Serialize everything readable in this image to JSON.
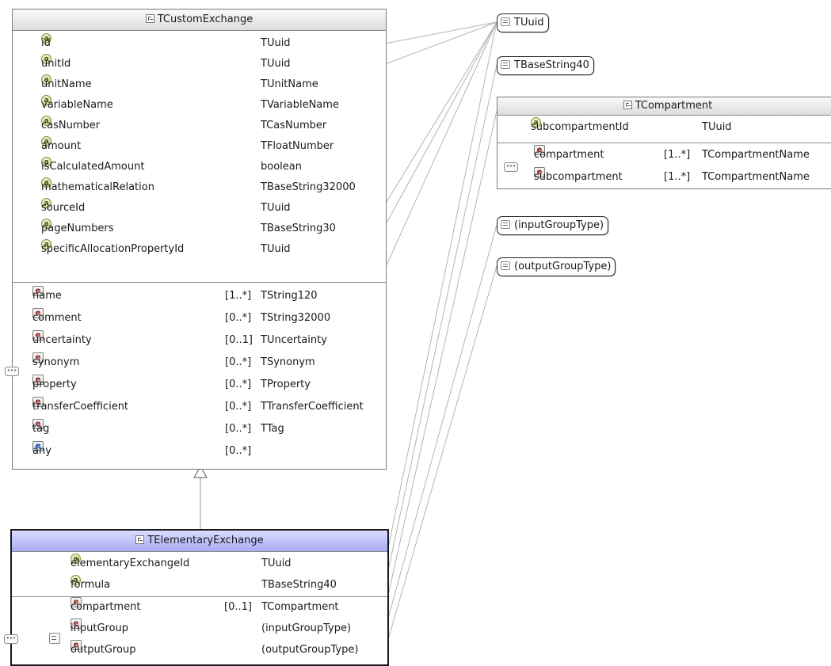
{
  "custom": {
    "title": "TCustomExchange",
    "attributes": [
      {
        "name": "id",
        "type": "TUuid"
      },
      {
        "name": "unitId",
        "type": "TUuid"
      },
      {
        "name": "unitName",
        "type": "TUnitName"
      },
      {
        "name": "variableName",
        "type": "TVariableName"
      },
      {
        "name": "casNumber",
        "type": "TCasNumber"
      },
      {
        "name": "amount",
        "type": "TFloatNumber"
      },
      {
        "name": "isCalculatedAmount",
        "type": "boolean"
      },
      {
        "name": "mathematicalRelation",
        "type": "TBaseString32000"
      },
      {
        "name": "sourceId",
        "type": "TUuid"
      },
      {
        "name": "pageNumbers",
        "type": "TBaseString30"
      },
      {
        "name": "specificAllocationPropertyId",
        "type": "TUuid"
      }
    ],
    "elements": [
      {
        "name": "name",
        "card": "[1..*]",
        "type": "TString120"
      },
      {
        "name": "comment",
        "card": "[0..*]",
        "type": "TString32000"
      },
      {
        "name": "uncertainty",
        "card": "[0..1]",
        "type": "TUncertainty"
      },
      {
        "name": "synonym",
        "card": "[0..*]",
        "type": "TSynonym"
      },
      {
        "name": "property",
        "card": "[0..*]",
        "type": "TProperty"
      },
      {
        "name": "transferCoefficient",
        "card": "[0..*]",
        "type": "TTransferCoefficient"
      },
      {
        "name": "tag",
        "card": "[0..*]",
        "type": "TTag"
      },
      {
        "name": "any",
        "card": "[0..*]",
        "type": ""
      }
    ]
  },
  "elementary": {
    "title": "TElementaryExchange",
    "attributes": [
      {
        "name": "elementaryExchangeId",
        "type": "TUuid"
      },
      {
        "name": "formula",
        "type": "TBaseString40"
      }
    ],
    "elements": [
      {
        "name": "compartment",
        "card": "[0..1]",
        "type": "TCompartment"
      },
      {
        "name": "inputGroup",
        "card": "",
        "type": "(inputGroupType)"
      },
      {
        "name": "outputGroup",
        "card": "",
        "type": "(outputGroupType)"
      }
    ]
  },
  "compartment": {
    "title": "TCompartment",
    "attributes": [
      {
        "name": "subcompartmentId",
        "type": "TUuid"
      }
    ],
    "elements": [
      {
        "name": "compartment",
        "card": "[1..*]",
        "type": "TCompartmentName"
      },
      {
        "name": "subcompartment",
        "card": "[1..*]",
        "type": "TCompartmentName"
      }
    ]
  },
  "simpleTypes": {
    "tuuid": "TUuid",
    "tbasestring40": "TBaseString40",
    "input_group_type": "(inputGroupType)",
    "output_group_type": "(outputGroupType)"
  }
}
